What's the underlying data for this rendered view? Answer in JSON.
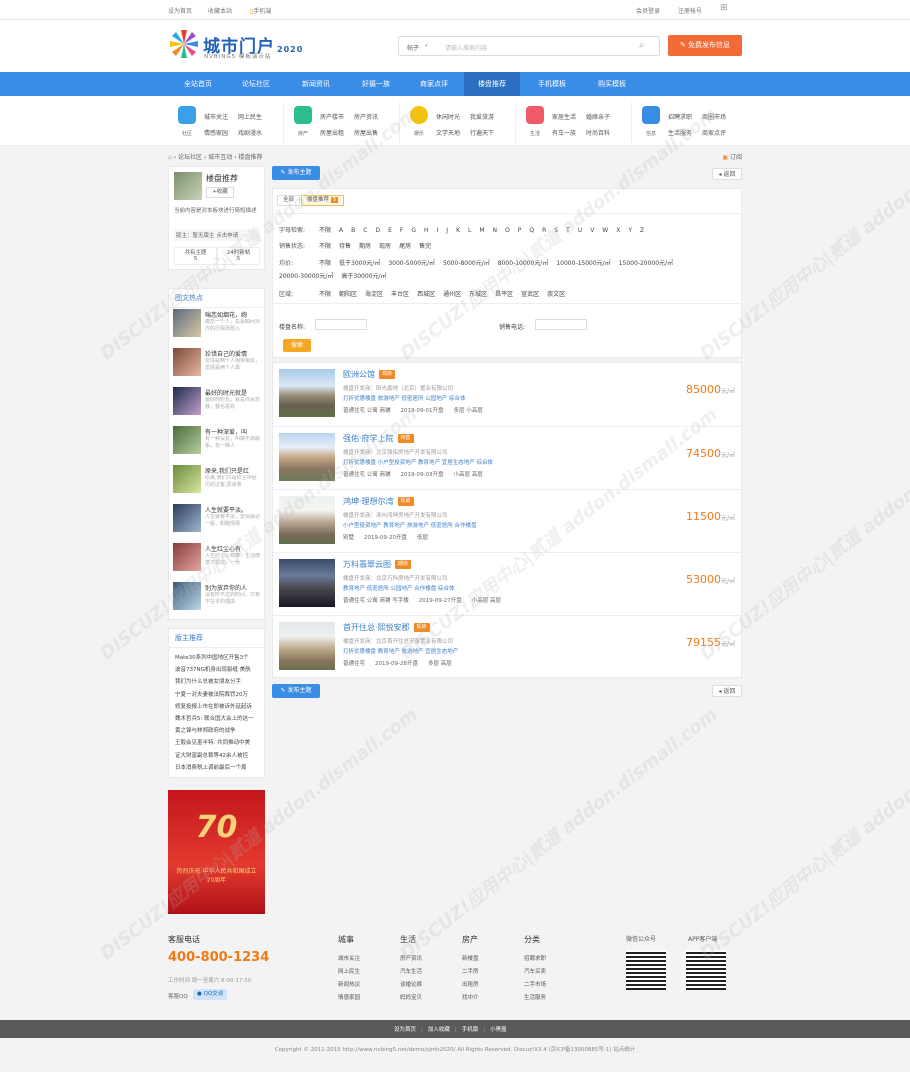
{
  "topbar": {
    "set_home": "设为首页",
    "bookmark": "收藏本站",
    "mobile": "手机端",
    "login": "会员登录",
    "register": "注册帐号"
  },
  "header": {
    "logo_text": "城市门户",
    "logo_year": "2020",
    "logo_sub": "NVBING5 模板演示站",
    "search_type": "帖子",
    "search_placeholder": "请输入搜索内容",
    "post_button": "免费发布信息"
  },
  "nav": {
    "items": [
      "全站首页",
      "论坛社区",
      "新闻资讯",
      "好摄一族",
      "商家点评",
      "楼盘推荐",
      "手机模板",
      "购买模板"
    ],
    "active_index": 5
  },
  "categories": [
    {
      "name": "社区",
      "color": "#3aa0e8",
      "links": [
        "城市关注",
        "网上民生",
        "情感家园",
        "戏剧漫水"
      ]
    },
    {
      "name": "房产",
      "color": "#2bbf8e",
      "links": [
        "房产楼市",
        "房产资讯",
        "房屋出租",
        "房屋出售"
      ]
    },
    {
      "name": "娱乐",
      "color": "#f4c20d",
      "links": [
        "休闲时光",
        "我爱旅游",
        "文学天地",
        "行遍天下"
      ]
    },
    {
      "name": "生活",
      "color": "#f05a6a",
      "links": [
        "家居生活",
        "婚嫁亲子",
        "有车一族",
        "时尚百科"
      ]
    },
    {
      "name": "信息",
      "color": "#3a8de6",
      "links": [
        "招聘求职",
        "商圈市场",
        "生活服务",
        "商家点评"
      ]
    }
  ],
  "breadcrumb": {
    "items": [
      "论坛社区",
      "城市互动",
      "楼盘推荐"
    ],
    "rss": "订阅"
  },
  "forum": {
    "name": "楼盘推荐",
    "fav": "收藏",
    "desc": "当前内容是对本板块进行简短描述",
    "moderator": "版主：暂无版主 点击申请",
    "stat1_label": "共有主题",
    "stat1_value": "5",
    "stat2_label": "24时新帖",
    "stat2_value": "5"
  },
  "hot_title": "图文热点",
  "hot_items": [
    {
      "title": "喘恋如烟花，绚",
      "desc": "瘦恋一个人，总会瞬间对方的行踪而陷入"
    },
    {
      "title": "珍惜自己的爱情",
      "desc": "爱情是两个人相亲相爱，爱情是两个人靠"
    },
    {
      "title": "最好的时光就是",
      "desc": "最好的时光，就是你喜欢我，我也喜欢"
    },
    {
      "title": "有一种深爱，叫",
      "desc": "有一种深爱，叫做不再联系，有一种人"
    },
    {
      "title": "原来,我们只是红",
      "desc": "原来,我们只是红尘中经历的过客,原来我"
    },
    {
      "title": "人生就要平淡。",
      "desc": "人生就要平淡，爱情就必一般，和睦情情"
    },
    {
      "title": "人生红尘心有",
      "desc": "人生红尘心有察，生活随意才愉快，一份"
    },
    {
      "title": "别为放弃你的人",
      "desc": "没有所不过的时间，只有不在乎的理由"
    }
  ],
  "rec_title": "版主推荐",
  "rec_items": [
    "Mate30系列中国地区开售3个",
    "波音737NG机身出现裂缝 美航",
    "我们为什么总被女朋友分手",
    "宁夏一对夫妻被法院裁罚20万",
    "修复投报上市在即被诉外延起诉",
    "魏木哲兵5: 联合国大会上的这一",
    "黄之锋与林郑政府的战争",
    "王毅会见墨半特: 共同推动中美",
    "证大财富副总裁等42余人被控",
    "日本消费税上调前最后一个周"
  ],
  "ad_text": "热烈庆祝 中华人民共和国成立70周年",
  "ad_number": "70",
  "toolbar": {
    "post": "发布主题",
    "back": "返回"
  },
  "tabs": {
    "all": "全部",
    "current": "楼盘推荐",
    "count": "5"
  },
  "filters": {
    "letter_label": "字母检索:",
    "letters": [
      "不限",
      "A",
      "B",
      "C",
      "D",
      "E",
      "F",
      "G",
      "H",
      "I",
      "J",
      "K",
      "L",
      "M",
      "N",
      "O",
      "P",
      "Q",
      "R",
      "S",
      "T",
      "U",
      "V",
      "W",
      "X",
      "Y",
      "Z"
    ],
    "status_label": "销售状态:",
    "status": [
      "不限",
      "待售",
      "期房",
      "现房",
      "尾房",
      "售完"
    ],
    "price_label": "均价:",
    "prices": [
      "不限",
      "低于3000元/㎡",
      "3000-5000元/㎡",
      "5000-8000元/㎡",
      "8000-10000元/㎡",
      "10000-15000元/㎡",
      "15000-20000元/㎡",
      "20000-30000元/㎡",
      "高于30000元/㎡"
    ],
    "area_label": "区域:",
    "areas": [
      "不限",
      "朝阳区",
      "海淀区",
      "丰台区",
      "西城区",
      "通州区",
      "东城区",
      "昌平区",
      "宣武区",
      "崇文区"
    ],
    "name_label": "楼盘名称:",
    "phone_label": "销售电话:",
    "search_btn": "搜索"
  },
  "listings": [
    {
      "title": "欧洲公馆",
      "status": "现房",
      "developer": "楼盘开发商：阳光鑫地（北京）置业有限公司",
      "tags": "打折优惠楼盘 旅游地产 低密居所 公园地产 综合体",
      "type": "普通住宅 公寓 商铺",
      "date": "2019-09-01开盘",
      "height": "多层 小高层",
      "price": "85000",
      "unit": "元/㎡"
    },
    {
      "title": "强佑·府学上院",
      "status": "待售",
      "developer": "楼盘开发商：北京强佑房地产开发有限公司",
      "tags": "打折优惠楼盘 小户型投资地产 教育地产 宜居生态地产 综合体",
      "type": "普通住宅 公寓 商铺",
      "date": "2019-09-03开盘",
      "height": "小高层 高层",
      "price": "74500",
      "unit": "元/㎡"
    },
    {
      "title": "鸿坤·理想尔湾",
      "status": "现房",
      "developer": "楼盘开发商：涿州鸿坤房地产开发有限公司",
      "tags": "小户型投资地产 教育地产 旅游地产 低密居所 合作楼盘",
      "type": "别墅",
      "date": "2019-09-20开盘",
      "height": "低层",
      "price": "11500",
      "unit": "元/㎡"
    },
    {
      "title": "万科翡翠云图",
      "status": "期房",
      "developer": "楼盘开发商：北京万科房地产开发有限公司",
      "tags": "教育地产 低密居所 公园地产 合作楼盘 综合体",
      "type": "普通住宅 公寓 商铺 写字楼",
      "date": "2019-09-27开盘",
      "height": "小高层 高层",
      "price": "53000",
      "unit": "元/㎡"
    },
    {
      "title": "首开住总·熙悦安郡",
      "status": "现房",
      "developer": "楼盘开发商：北京首开住总安泰置业有限公司",
      "tags": "打折优惠楼盘 教育地产 旅游地产 宜居生态地产",
      "type": "普通住宅",
      "date": "2019-09-28开盘",
      "height": "多层 高层",
      "price": "79155",
      "unit": "元/㎡"
    }
  ],
  "footer": {
    "service_title": "客服电话",
    "phone": "400-800-1234",
    "hours": "工作时间 周一至周六 8:00-17:30",
    "qq_label": "客服QQ",
    "qq_btn": "QQ交谈",
    "cols": [
      {
        "title": "城事",
        "links": [
          "城市关注",
          "网上民生",
          "新闻热议",
          "情感家园"
        ]
      },
      {
        "title": "生活",
        "links": [
          "房产资讯",
          "汽车生活",
          "谈婚论嫁",
          "妈妈宝贝"
        ]
      },
      {
        "title": "房产",
        "links": [
          "新楼盘",
          "二手房",
          "出租房",
          "找中介"
        ]
      },
      {
        "title": "分类",
        "links": [
          "招聘求职",
          "汽车买卖",
          "二手市场",
          "生活服务"
        ]
      }
    ],
    "wechat": "微信公众号",
    "app": "APP客户端",
    "bar_links": [
      "设为首页",
      "加入收藏",
      "手机版",
      "小黑屋"
    ],
    "copyright": "Copyright © 2011-2015 http://www.nvbing5.net/demo/cjmh2020/ All Rights Reserved. Discuz!X3.4 (京ICP备13000885号-1) 站点统计"
  },
  "watermark": "DISCUZ!应用中心|贰道 addon.dismall.com"
}
